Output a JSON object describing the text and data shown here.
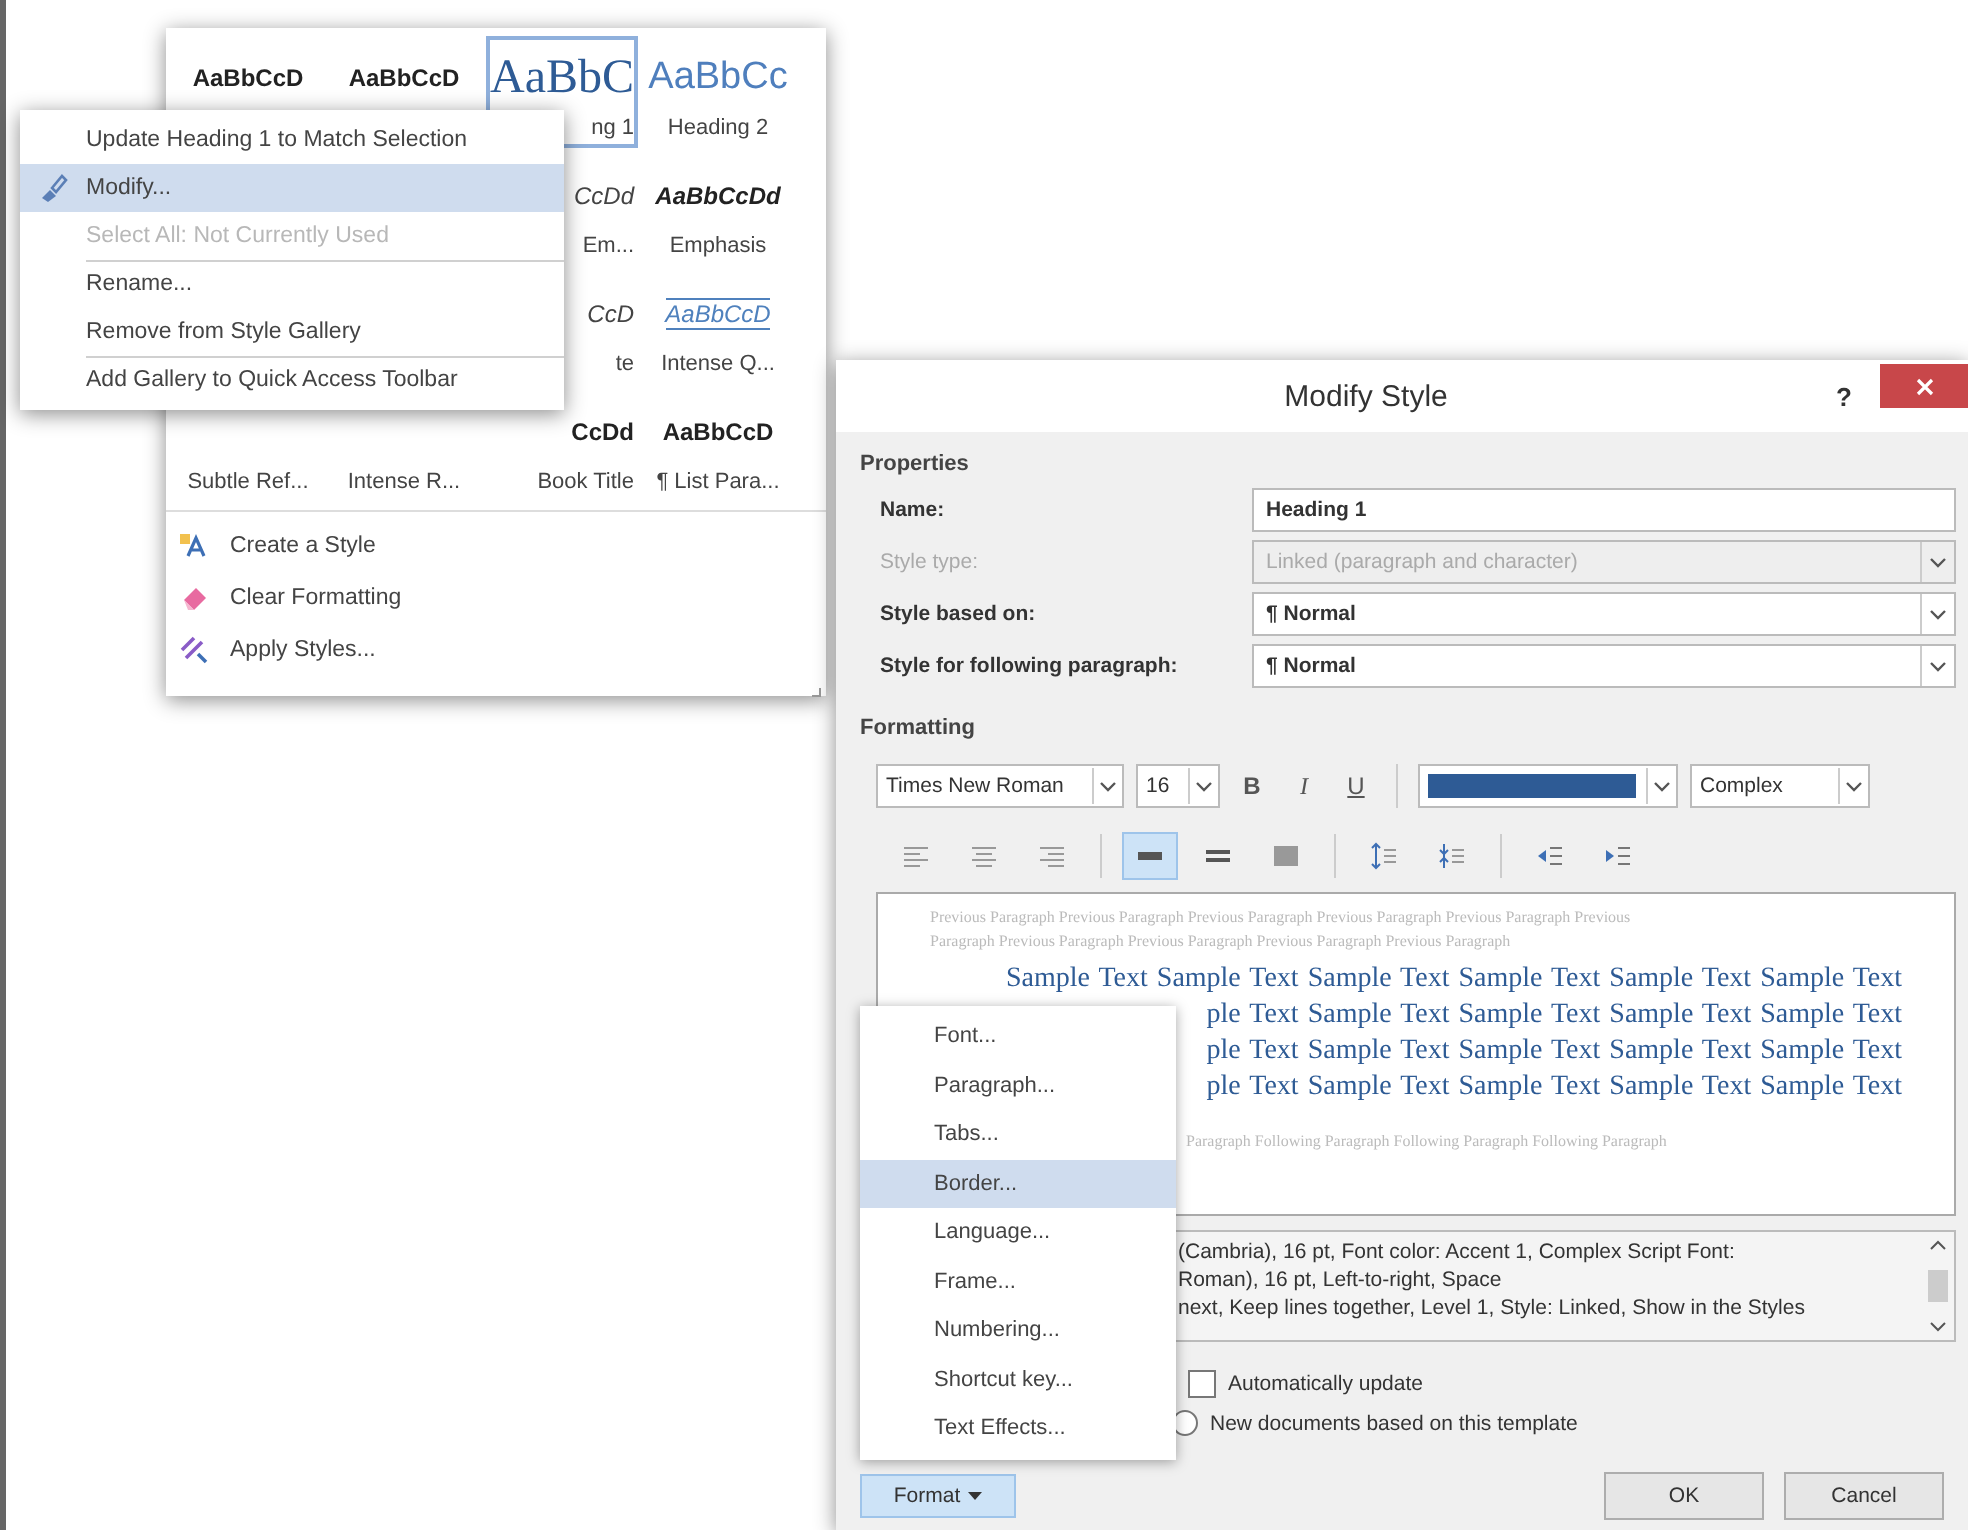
{
  "gallery": {
    "cells": [
      {
        "sample": "AaBbCcD",
        "kind": "normal",
        "selected": false
      },
      {
        "sample": "AaBbCcD",
        "kind": "normal",
        "selected": false
      },
      {
        "sample": "AaBbC",
        "label": "ng 1",
        "kind": "heading-1",
        "selected": true
      },
      {
        "sample": "AaBbCc",
        "label": "Heading 2",
        "kind": "heading-2",
        "selected": false
      },
      {
        "kind": "covered"
      },
      {
        "kind": "covered"
      },
      {
        "sample": "CcDd",
        "label": "Em...",
        "kind": "italic",
        "selected": false
      },
      {
        "sample": "AaBbCcDd",
        "label": "Emphasis",
        "kind": "bold-italic",
        "selected": false
      },
      {
        "kind": "covered"
      },
      {
        "kind": "covered"
      },
      {
        "sample": "CcD",
        "label": "te",
        "kind": "italic",
        "selected": false
      },
      {
        "sample": "AaBbCcD",
        "label": "Intense Q...",
        "kind": "intense-quote",
        "selected": false
      },
      {
        "label": "Subtle Ref...",
        "selected": false
      },
      {
        "label": "Intense R...",
        "selected": false
      },
      {
        "sample": "CcDd",
        "label": "Book Title",
        "kind": "bold",
        "selected": false
      },
      {
        "sample": "AaBbCcD",
        "label": "¶ List Para...",
        "kind": "normal",
        "selected": false
      }
    ],
    "commands": [
      {
        "label": "Create a Style",
        "kind": "create"
      },
      {
        "label": "Clear Formatting",
        "kind": "clear"
      },
      {
        "label": "Apply Styles...",
        "kind": "apply"
      }
    ]
  },
  "context_menu": {
    "items": [
      {
        "label": "Update Heading 1 to Match Selection",
        "selected": false,
        "disabled": false,
        "divider_above": false
      },
      {
        "label": "Modify...",
        "selected": true,
        "disabled": false,
        "divider_above": false,
        "kind": "brush"
      },
      {
        "label": "Select All: Not Currently Used",
        "selected": false,
        "disabled": true,
        "divider_above": false
      },
      {
        "label": "Rename...",
        "selected": false,
        "disabled": false,
        "divider_above": true
      },
      {
        "label": "Remove from Style Gallery",
        "selected": false,
        "disabled": false,
        "divider_above": false
      },
      {
        "label": "Add Gallery to Quick Access Toolbar",
        "selected": false,
        "disabled": false,
        "divider_above": true
      }
    ]
  },
  "dialog": {
    "title": "Modify Style",
    "help": "?",
    "properties": {
      "heading": "Properties",
      "fields": [
        {
          "label": "Name:",
          "value": "Heading 1",
          "kind": "text",
          "disabled": false
        },
        {
          "label": "Style type:",
          "value": "Linked (paragraph and character)",
          "kind": "dropdown",
          "disabled": true
        },
        {
          "label": "Style based on:",
          "value": "¶ Normal",
          "kind": "dropdown",
          "disabled": false
        },
        {
          "label": "Style for following paragraph:",
          "value": "¶ Normal",
          "kind": "dropdown",
          "disabled": false
        }
      ]
    },
    "formatting": {
      "heading": "Formatting",
      "font": "Times New Roman",
      "size": "16",
      "bold": "B",
      "italic": "I",
      "underline": "U",
      "color": "#2e5b95",
      "script": "Complex",
      "paragraph_buttons": [
        {
          "kind": "align-left",
          "selected": false
        },
        {
          "kind": "align-center",
          "selected": false
        },
        {
          "kind": "align-right",
          "selected": false
        },
        {
          "kind": "spacing-single",
          "selected": true
        },
        {
          "kind": "spacing-half",
          "selected": false
        },
        {
          "kind": "spacing-double",
          "selected": false
        },
        {
          "kind": "space-before",
          "selected": false
        },
        {
          "kind": "space-after",
          "selected": false
        },
        {
          "kind": "indent-decrease",
          "selected": false
        },
        {
          "kind": "indent-increase",
          "selected": false
        }
      ]
    },
    "preview": {
      "previous": [
        "Previous Paragraph Previous Paragraph Previous Paragraph Previous Paragraph Previous Paragraph Previous",
        "Paragraph Previous Paragraph Previous Paragraph Previous Paragraph Previous Paragraph"
      ],
      "sample": [
        "Sample Text Sample Text Sample Text Sample Text Sample Text Sample Text",
        "ple Text Sample Text Sample Text Sample Text Sample Text",
        "ple Text Sample Text Sample Text Sample Text Sample Text",
        "ple Text Sample Text Sample Text Sample Text Sample Text"
      ],
      "following": [
        "Paragraph Following Paragraph Following Paragraph Following Paragraph"
      ]
    },
    "description": [
      "(Cambria), 16 pt, Font color: Accent 1, Complex Script Font:",
      "Roman), 16 pt, Left-to-right, Space",
      "next, Keep lines together, Level 1, Style: Linked, Show in the Styles"
    ],
    "auto_update": {
      "label": "Automatically update",
      "checked": false
    },
    "template_option": {
      "label": "New documents based on this template",
      "selected": false
    },
    "format_button": "Format",
    "buttons": [
      "OK",
      "Cancel"
    ]
  },
  "format_menu": {
    "items": [
      {
        "label": "Font...",
        "selected": false
      },
      {
        "label": "Paragraph...",
        "selected": false
      },
      {
        "label": "Tabs...",
        "selected": false
      },
      {
        "label": "Border...",
        "selected": true
      },
      {
        "label": "Language...",
        "selected": false
      },
      {
        "label": "Frame...",
        "selected": false
      },
      {
        "label": "Numbering...",
        "selected": false
      },
      {
        "label": "Shortcut key...",
        "selected": false
      },
      {
        "label": "Text Effects...",
        "selected": false
      }
    ]
  }
}
